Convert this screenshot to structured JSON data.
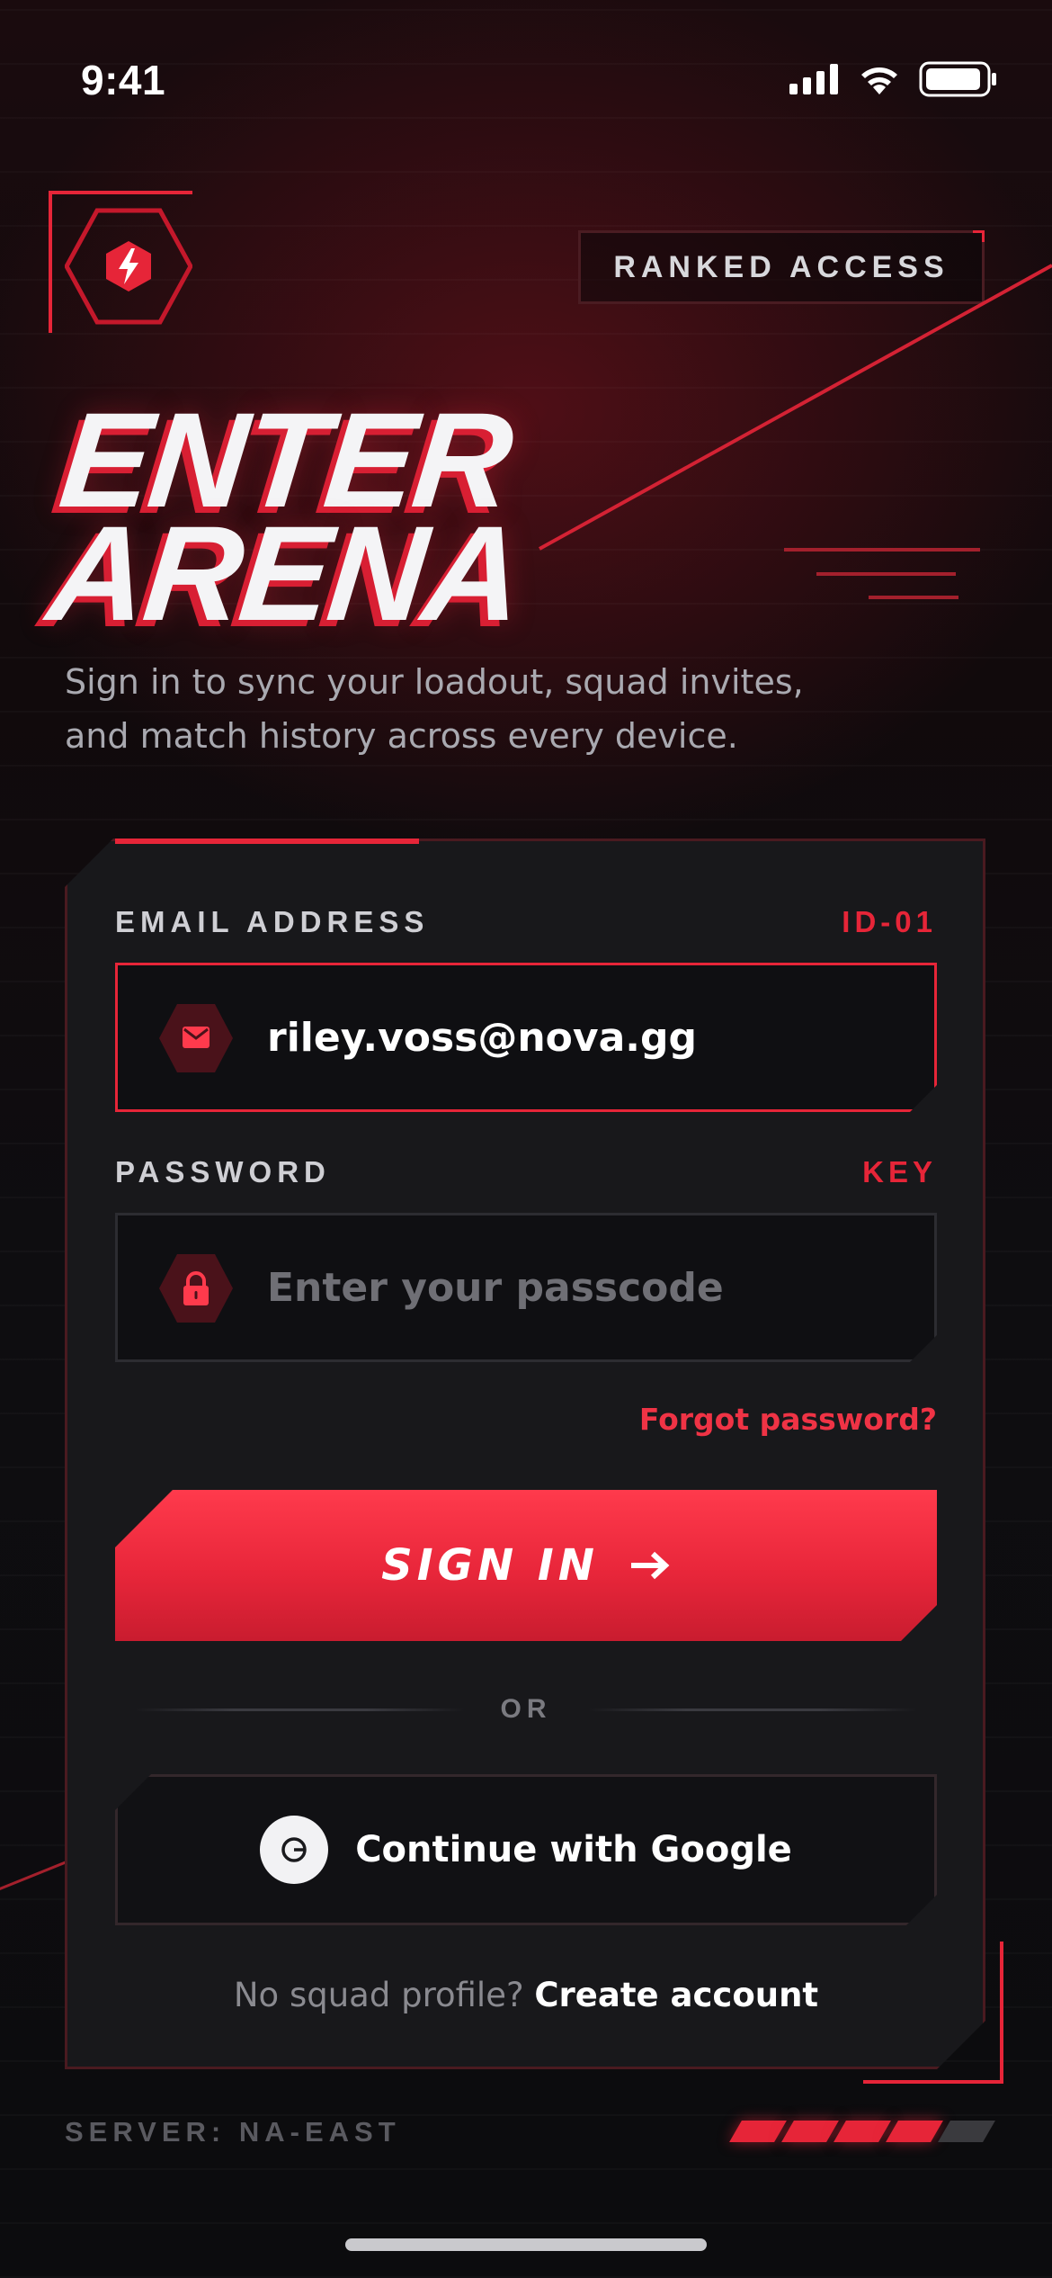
{
  "status_bar": {
    "time": "9:41"
  },
  "header": {
    "badge_label": "RANKED ACCESS",
    "title_line1": "ENTER",
    "title_line2": "ARENA",
    "subtitle_line1": "Sign in to sync your loadout, squad invites,",
    "subtitle_line2": "and match history across every device."
  },
  "form": {
    "email": {
      "label": "EMAIL ADDRESS",
      "tag": "ID-01",
      "value": "riley.voss@nova.gg",
      "icon": "mail-icon"
    },
    "password": {
      "label": "PASSWORD",
      "tag": "KEY",
      "value": "",
      "placeholder": "Enter your passcode",
      "icon": "lock-icon"
    },
    "forgot_label": "Forgot password?",
    "signin_label": "SIGN IN",
    "divider_label": "OR",
    "google_label": "Continue with Google",
    "signup_prompt": "No squad profile?",
    "signup_link": "Create account"
  },
  "footer": {
    "server_label": "SERVER: NA-EAST",
    "signal_level": 0.8
  },
  "colors": {
    "accent": "#e62538",
    "background": "#0d0d10",
    "card": "#18181b"
  }
}
